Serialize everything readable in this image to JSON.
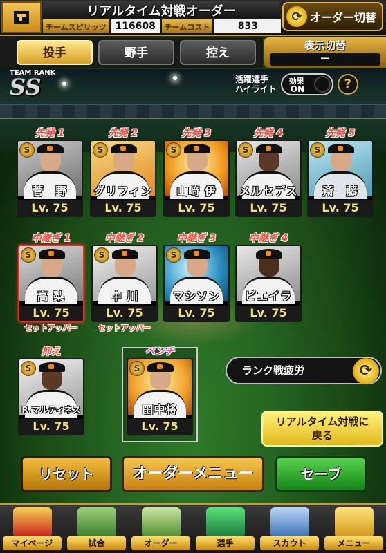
{
  "header": {
    "title": "リアルタイム対戦オーダー",
    "team_spirit_label": "チームスピリッツ",
    "team_spirit_value": "116608",
    "team_cost_label": "チームコスト",
    "team_cost_value": "833",
    "order_switch_label": "オーダー切替"
  },
  "tabs": [
    {
      "label": "投手",
      "active": true
    },
    {
      "label": "野手",
      "active": false
    },
    {
      "label": "控え",
      "active": false
    }
  ],
  "display_switch": {
    "label": "表示切替",
    "value": "ー"
  },
  "team_rank": {
    "label": "TEAM RANK",
    "value": "SS"
  },
  "highlight": {
    "label_line1": "活躍選手",
    "label_line2": "ハイライト",
    "toggle_title": "効果",
    "toggle_state": "ON"
  },
  "help_icon": "?",
  "badge_text": "S",
  "starters": [
    {
      "slot": "先発 1",
      "name": "菅　野",
      "level": "Lv. 75"
    },
    {
      "slot": "先発 2",
      "name": "グリフィン",
      "level": "Lv. 75"
    },
    {
      "slot": "先発 3",
      "name": "山﨑 伊",
      "level": "Lv. 75"
    },
    {
      "slot": "先発 4",
      "name": "メルセデス",
      "level": "Lv. 75"
    },
    {
      "slot": "先発 5",
      "name": "斎　藤",
      "level": "Lv. 75"
    }
  ],
  "relievers": [
    {
      "slot": "中継ぎ 1",
      "name": "高 梨",
      "level": "Lv. 75",
      "sub": "セットアッパー"
    },
    {
      "slot": "中継ぎ 2",
      "name": "中 川",
      "level": "Lv. 75",
      "sub": "セットアッパー"
    },
    {
      "slot": "中継ぎ 3",
      "name": "マシソン",
      "level": "Lv. 75",
      "sub": ""
    },
    {
      "slot": "中継ぎ 4",
      "name": "ビエイラ",
      "level": "Lv. 75",
      "sub": ""
    }
  ],
  "closer": {
    "slot": "抑え",
    "name": "R.マルティネス",
    "level": "Lv. 75"
  },
  "bench": {
    "slot": "ベンチ",
    "name": "田中将",
    "level": "Lv. 75"
  },
  "rank_fatigue_label": "ランク戦疲労",
  "back_button": {
    "line1": "リアルタイム対戦に",
    "line2": "戻る"
  },
  "buttons": {
    "reset": "リセット",
    "order_menu": "オーダーメニュー",
    "save": "セーブ"
  },
  "nav": [
    {
      "label": "マイページ",
      "icon": "mypage-icon"
    },
    {
      "label": "試合",
      "icon": "stadium-icon"
    },
    {
      "label": "オーダー",
      "icon": "order-icon"
    },
    {
      "label": "選手",
      "icon": "player-icon"
    },
    {
      "label": "スカウト",
      "icon": "scout-icon"
    },
    {
      "label": "メニュー",
      "icon": "menu-icon"
    }
  ],
  "colors": {
    "accent_gold": "#e5b442",
    "slot_label_red": "#ff4a3d",
    "save_green": "#17851a",
    "level_yellow": "#f4e27a"
  }
}
